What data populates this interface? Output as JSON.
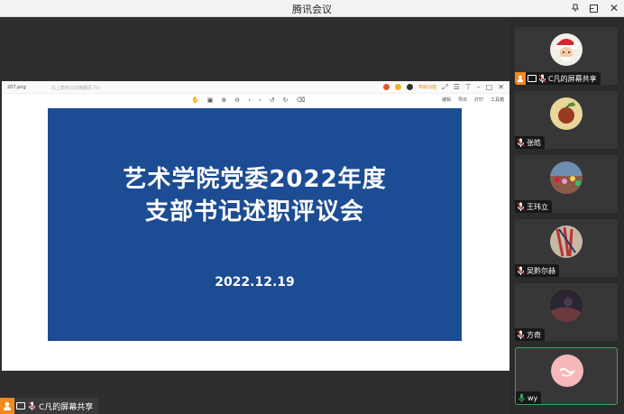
{
  "window": {
    "title": "腾讯会议"
  },
  "viewer": {
    "file_name": "207.png",
    "hint_text": "右上角可以切换翻页 (V)",
    "badge_text": "新版功能",
    "tools_right": [
      "编辑",
      "导出",
      "打印",
      "工具箱"
    ]
  },
  "slide": {
    "title_line1": "艺术学院党委2022年度",
    "title_line2": "支部书记述职评议会",
    "date": "2022.12.19",
    "background": "#1c4c93"
  },
  "sharer_bar": {
    "label": "C凡的屏幕共享"
  },
  "participants": [
    {
      "name": "C凡的屏幕共享",
      "avatar": "santa-avatar-icon",
      "sharing": true
    },
    {
      "name": "张皓",
      "avatar": "fruit-avatar-icon",
      "sharing": false
    },
    {
      "name": "王玮立",
      "avatar": "crowd-avatar-icon",
      "sharing": false
    },
    {
      "name": "吴黔尔赫",
      "avatar": "fabric-avatar-icon",
      "sharing": false
    },
    {
      "name": "方奇",
      "avatar": "dark-avatar-icon",
      "sharing": false
    },
    {
      "name": "wy",
      "avatar": "pink-avatar-icon",
      "sharing": false,
      "speaking": true
    }
  ],
  "colors": {
    "accent_orange": "#f28a1b",
    "speaking_green": "#3aa55d"
  }
}
